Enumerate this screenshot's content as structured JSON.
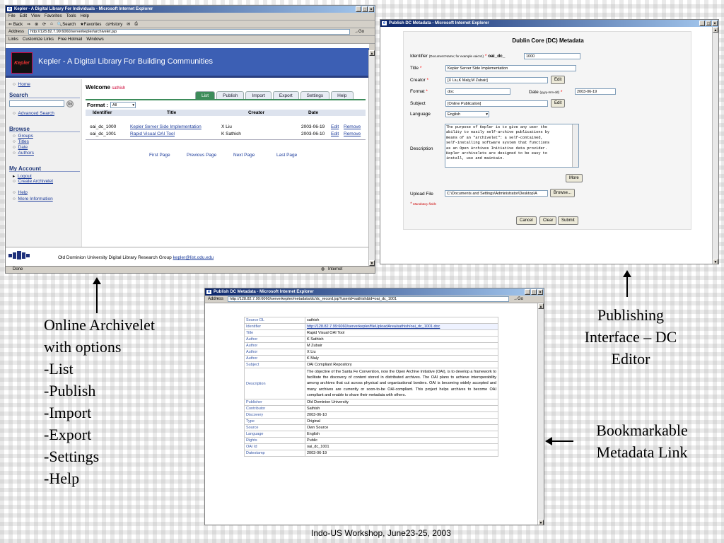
{
  "browser1": {
    "title": "Kepler - A Digital Library For Individuals - Microsoft Internet Explorer",
    "menu": [
      "File",
      "Edit",
      "View",
      "Favorites",
      "Tools",
      "Help"
    ],
    "toolbar": [
      "Back",
      "Search",
      "Favorites",
      "History"
    ],
    "address_label": "Address",
    "address": "http://128.82.7.99:6060/serverkepler/archivelet.jsp",
    "go": "Go",
    "links": [
      "Links",
      "Customize Links",
      "Free Hotmail",
      "Windows"
    ],
    "banner_logo": "Kepler",
    "banner_title": "Kepler - A Digital Library For Building Communities",
    "sidebar": {
      "home": "Home",
      "search_heading": "Search",
      "go_btn": "Go",
      "advanced": "Advanced Search",
      "browse_heading": "Browse",
      "browse_items": [
        "Groups",
        "Titles",
        "Date",
        "Authors"
      ],
      "account_heading": "My Account",
      "account_items": [
        "Logout",
        "Create Archivelet"
      ],
      "help": "Help",
      "more_info": "More Information"
    },
    "welcome": "Welcome",
    "user": "sathish",
    "tabs": [
      "List",
      "Publish",
      "Import",
      "Export",
      "Settings",
      "Help"
    ],
    "format_label": "Format :",
    "format_value": "All",
    "columns": [
      "Identifier",
      "Title",
      "Creator",
      "Date"
    ],
    "rows": [
      {
        "id": "oai_dc_1000",
        "title": "Kepler Server Side Implementation",
        "creator": "X Liu",
        "date": "2003-06-19",
        "edit": "Edit",
        "remove": "Remove"
      },
      {
        "id": "oai_dc_1001",
        "title": "Rapid Visual OAI Tool",
        "creator": "K Sathish",
        "date": "2003-06-10",
        "edit": "Edit",
        "remove": "Remove"
      }
    ],
    "pager": [
      "First Page",
      "Previous Page",
      "Next Page",
      "Last Page"
    ],
    "footer_text": "Old Dominion University Digital Library Research Group",
    "footer_email": "kepler@list.odu.edu",
    "status_done": "Done",
    "status_zone": "Internet"
  },
  "browser2": {
    "title": "Publish DC Metadata - Microsoft Internet Explorer",
    "heading": "Dublin Core (DC) Metadata",
    "identifier_label": "Identifier",
    "identifier_hint": "(Document Name; for example oaicn1)",
    "identifier_prefix": "oai_dc_",
    "identifier_value": "1000",
    "title_label": "Title",
    "title_value": "Kepler Server Side Implementation",
    "creator_label": "Creator",
    "creator_value": "[X Liu,K Maly,M Zubair]",
    "edit": "Edit",
    "format_label": "Format",
    "format_value": "doc",
    "date_label": "Date",
    "date_hint": "(yyyy-mm-dd)",
    "date_value": "2003-06-19",
    "subject_label": "Subject",
    "subject_value": "[Online Publication]",
    "language_label": "Language",
    "language_value": "English",
    "description_label": "Description",
    "description_lines": [
      "The purpose of Kepler is to give any user the",
      "ability to easily self-archive publications by",
      "means of an \"archivelet\": a self-contained,",
      "self-installing software system that functions",
      "as an Open Archives Initiative data provider.",
      "Kepler archivelets are designed to be easy to",
      "install, use and maintain."
    ],
    "more": "More",
    "upload_label": "Upload File",
    "upload_value": "C:\\Documents and Settings\\Administrator\\Desktop\\A",
    "browse": "Browse...",
    "mandatory": "Mandatory fields",
    "buttons": [
      "Cancel",
      "Clear",
      "Submit"
    ]
  },
  "browser3": {
    "title": "Publish DC Metadata - Microsoft Internet Explorer",
    "address_label": "Address",
    "address": "http://128.82.7.99:6060/serverkepler/metadata/dc/dc_record.jsp?userid=sathish&id=oai_dc_1001",
    "go": "Go",
    "rows": [
      {
        "k": "Source DL",
        "v": "sathish"
      },
      {
        "k": "Identifier",
        "v": "http://128.82.7.99:6060/serverkepler/fileUploadArea/sathish/oai_dc_1001.doc"
      },
      {
        "k": "Title",
        "v": "Rapid Visual OAI Tool"
      },
      {
        "k": "Author",
        "v": "K Sathish"
      },
      {
        "k": "Author",
        "v": "M Zubair"
      },
      {
        "k": "Author",
        "v": "X Liu"
      },
      {
        "k": "Author",
        "v": "K Maly"
      },
      {
        "k": "Subject",
        "v": "OAI Compliant Repository"
      },
      {
        "k": "Description",
        "v": "The objective of the Santa Fe Convention, now the Open Archive Initiative (OAI), is to develop a framework to facilitate the discovery of content stored in distributed archives. The OAI plans to achieve interoperability among archives that cut across physical and organizational borders. OAI is becoming widely accepted and many archives are currently or soon-to-be OAI-compliant. This project helps archives to become OAI compliant and enable to share their metadata with others."
      },
      {
        "k": "Publisher",
        "v": "Old Dominion University"
      },
      {
        "k": "Contributor",
        "v": "Sathish"
      },
      {
        "k": "Discovery",
        "v": "2003-06-10"
      },
      {
        "k": "Type",
        "v": "Original"
      },
      {
        "k": "Source",
        "v": "Own Source"
      },
      {
        "k": "Language",
        "v": "English"
      },
      {
        "k": "Rights",
        "v": "Public"
      },
      {
        "k": "OAI Id",
        "v": "oai_dc_1001"
      },
      {
        "k": "Datestamp",
        "v": "2003-06-19"
      }
    ]
  },
  "captions": {
    "archivelet": [
      "Online Archivelet",
      "with options",
      "-List",
      "-Publish",
      "-Import",
      "-Export",
      "-Settings",
      "-Help"
    ],
    "publishing": [
      "Publishing",
      "Interface – DC",
      "Editor"
    ],
    "bookmark": [
      "Bookmarkable",
      "Metadata Link"
    ],
    "footer": "Indo-US Workshop, June23-25, 2003"
  },
  "colors": {
    "banner": "#3c5fb4",
    "tab_active": "#3d8c5a",
    "title_bar": "#0a246a",
    "link": "#1a3a9a"
  }
}
